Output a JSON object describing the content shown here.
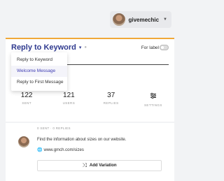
{
  "header": {
    "username": "givemechic"
  },
  "reply": {
    "title": "Reply to Keyword",
    "for_label": "For label",
    "menu": [
      {
        "label": "Reply to Keyword"
      },
      {
        "label": "Welcome Message"
      },
      {
        "label": "Reply to First Message"
      }
    ]
  },
  "stats": [
    {
      "value": "122",
      "label": "SENT"
    },
    {
      "value": "121",
      "label": "USERS"
    },
    {
      "value": "37",
      "label": "REPLIES"
    },
    {
      "value": "",
      "label": "SETTINGS"
    }
  ],
  "message": {
    "meta": "0 SENT · 0 REPLIES",
    "text": "Find the information about sizes on our website.",
    "link": "www.gmch.com/sizes",
    "add_variation": "Add Variation"
  },
  "colors": {
    "accent": "#f0a838",
    "title": "#2f3a8f",
    "menu_active": "#3d3bb3"
  },
  "icons": [
    "chevron-down-icon",
    "info-icon",
    "gear-icon",
    "globe-icon",
    "shuffle-icon"
  ]
}
